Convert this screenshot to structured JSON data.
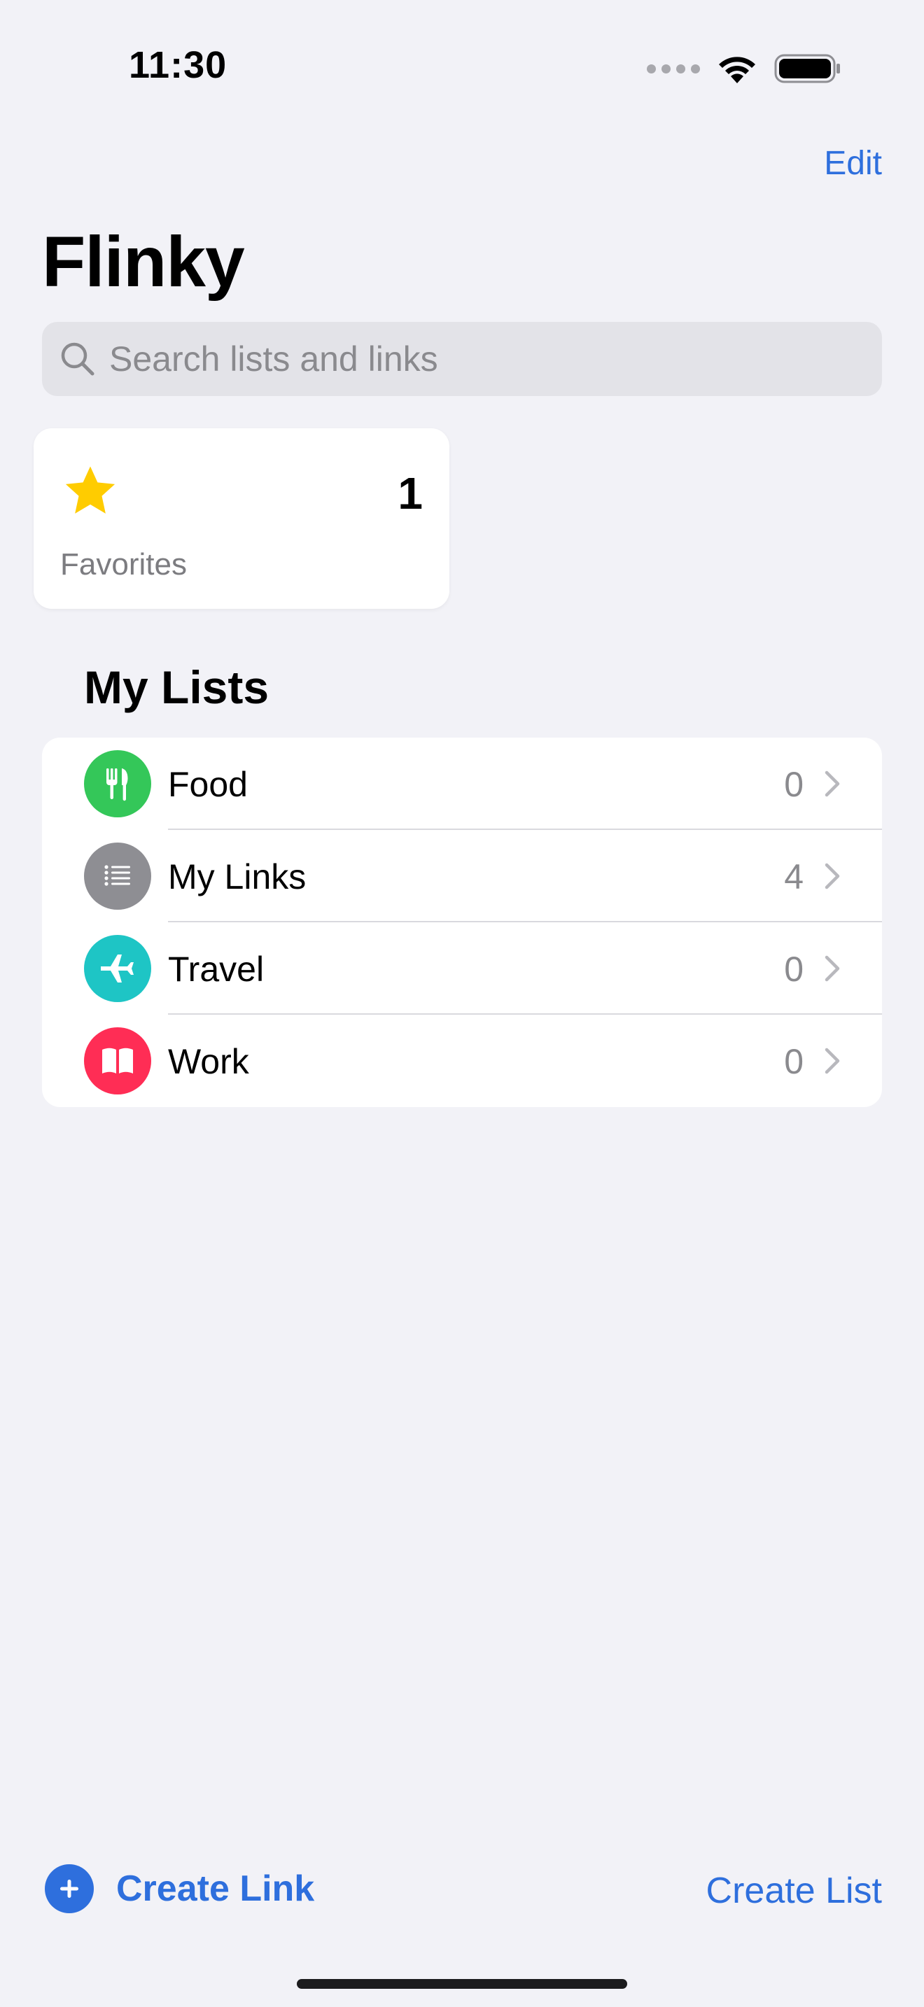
{
  "status_bar": {
    "time": "11:30"
  },
  "nav": {
    "edit_label": "Edit",
    "title": "Flinky"
  },
  "search": {
    "placeholder": "Search lists and links",
    "value": ""
  },
  "favorites": {
    "label": "Favorites",
    "count": "1",
    "color": "#FFCC00"
  },
  "section": {
    "title": "My Lists"
  },
  "lists": [
    {
      "name": "Food",
      "count": "0",
      "icon": "fork-knife-icon",
      "color": "#34C759"
    },
    {
      "name": "My Links",
      "count": "4",
      "icon": "list-icon",
      "color": "#8E8E93"
    },
    {
      "name": "Travel",
      "count": "0",
      "icon": "airplane-icon",
      "color": "#1EC5C5"
    },
    {
      "name": "Work",
      "count": "0",
      "icon": "book-icon",
      "color": "#FF2D55"
    }
  ],
  "toolbar": {
    "create_link": "Create Link",
    "create_list": "Create List"
  },
  "accent": "#2E6FDD"
}
